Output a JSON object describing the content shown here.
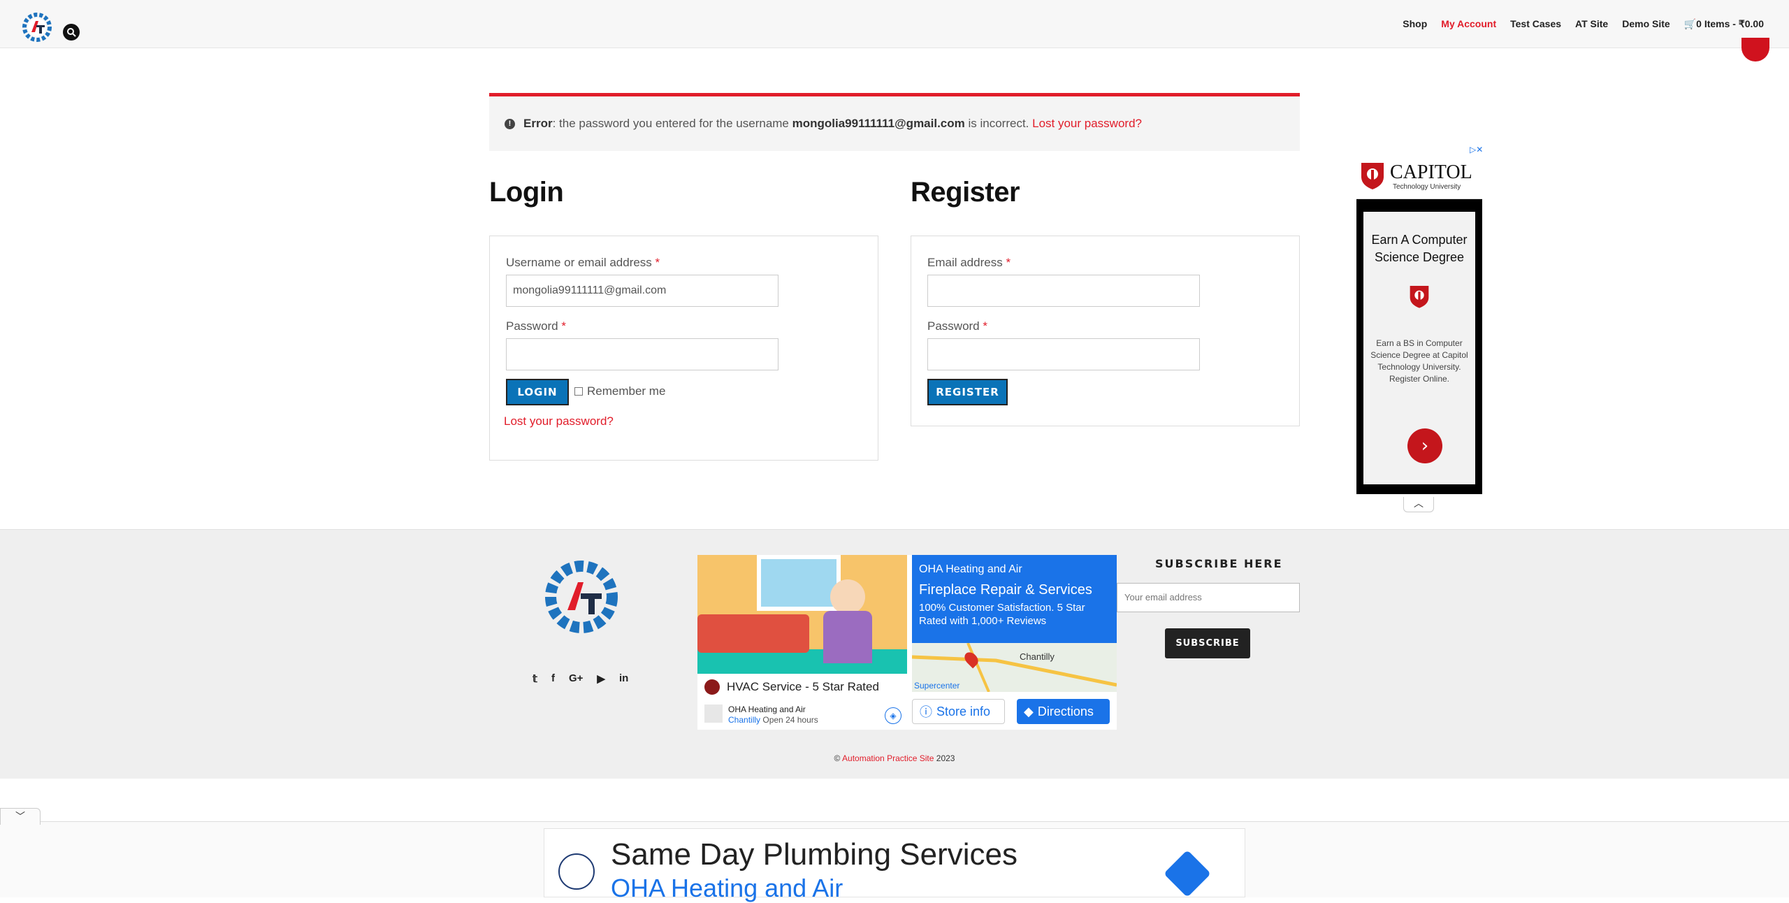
{
  "header": {
    "nav": [
      {
        "label": "Shop",
        "active": false
      },
      {
        "label": "My Account",
        "active": true
      },
      {
        "label": "Test Cases",
        "active": false
      },
      {
        "label": "AT Site",
        "active": false
      },
      {
        "label": "Demo Site",
        "active": false
      },
      {
        "label": "0 Items - ₹0.00",
        "active": false,
        "icon": "cart-icon"
      }
    ]
  },
  "error": {
    "label": "Error",
    "text_before": ": the password you entered for the username ",
    "username": "mongolia99111111@gmail.com",
    "text_after": " is incorrect. ",
    "link": "Lost your password?"
  },
  "login": {
    "title": "Login",
    "username_label": "Username or email address",
    "username_value": "mongolia99111111@gmail.com",
    "password_label": "Password",
    "required_mark": "*",
    "button": "LOGIN",
    "remember_label": "Remember me",
    "remember_checked": false,
    "lost_password": "Lost your password?"
  },
  "register": {
    "title": "Register",
    "email_label": "Email address",
    "password_label": "Password",
    "required_mark": "*",
    "button": "REGISTER"
  },
  "ad_right": {
    "brand": "CAPITOL",
    "brand_sub": "Technology University",
    "headline": "Earn A Computer Science Degree",
    "body": "Earn a BS in Computer Science Degree at Capitol Technology University. Register Online."
  },
  "footer": {
    "subscribe_title": "SUBSCRIBE HERE",
    "subscribe_placeholder": "Your email address",
    "subscribe_button": "SUBSCRIBE",
    "copyright_prefix": "© ",
    "copyright_link": "Automation Practice Site",
    "copyright_year": " 2023",
    "social": [
      "twitter-icon",
      "facebook-icon",
      "google-plus-icon",
      "youtube-icon",
      "linkedin-icon"
    ]
  },
  "ad_mid": {
    "left_title": "HVAC Service - 5 Star Rated",
    "left_company": "OHA Heating and Air",
    "left_location": "Chantilly",
    "left_hours": "Open 24 hours",
    "right_company": "OHA Heating and Air",
    "right_headline": "Fireplace Repair & Services",
    "right_desc": "100% Customer Satisfaction. 5 Star Rated with 1,000+ Reviews",
    "map_label": "Chantilly",
    "map_label2": "Supercenter",
    "store_info": "Store info",
    "directions": "Directions"
  },
  "anchor_ad": {
    "title": "Same Day Plumbing Services",
    "subtitle": "OHA Heating and Air"
  }
}
